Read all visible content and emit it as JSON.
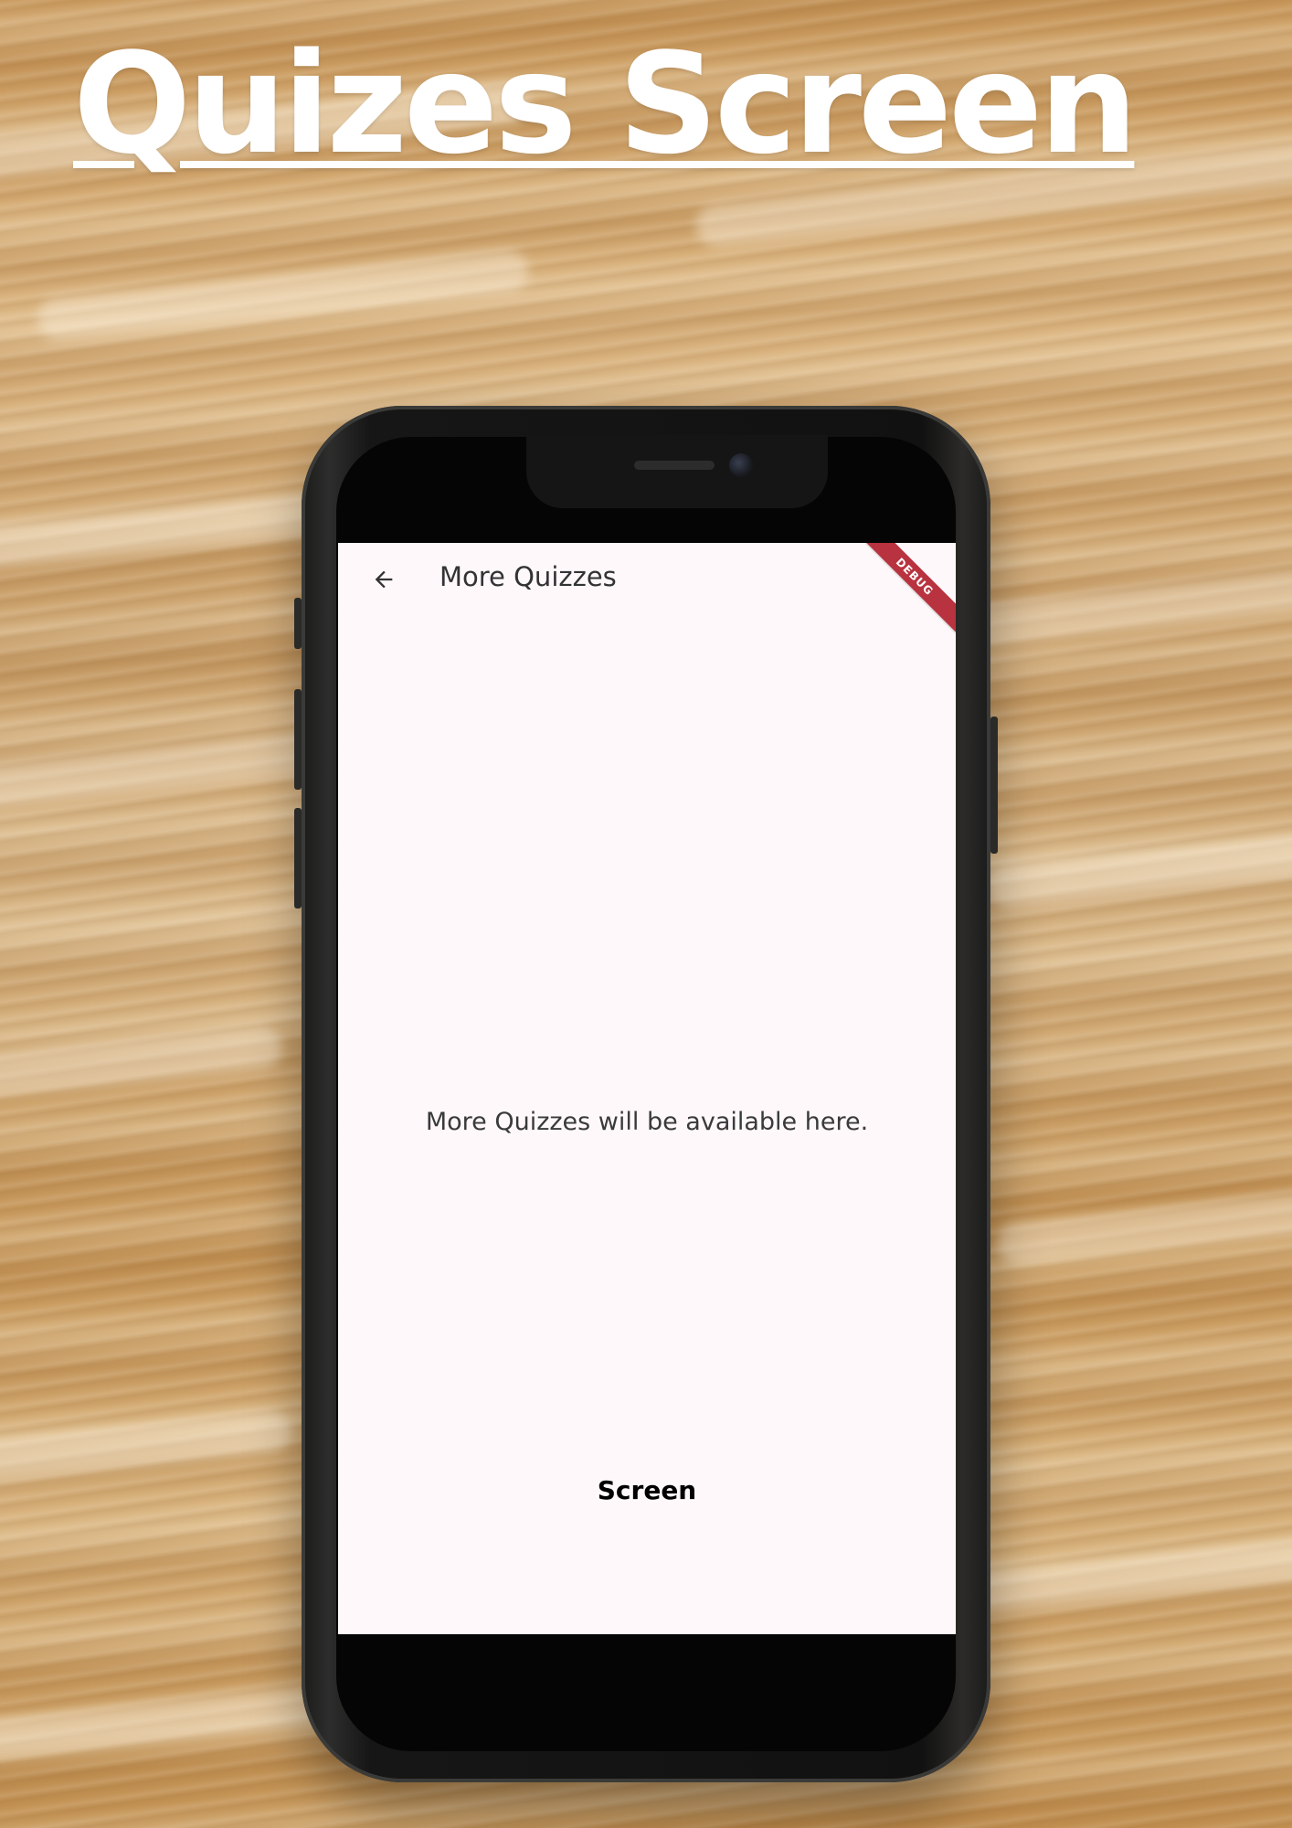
{
  "heading": {
    "title": "Quizes Screen"
  },
  "device": {
    "debug_banner": "DEBUG"
  },
  "app": {
    "appbar": {
      "back_icon": "arrow-left-icon",
      "title": "More Quizzes"
    },
    "body": {
      "message": "More Quizzes will be available here."
    },
    "footer_label": "Screen"
  },
  "colors": {
    "screen_background": "#fef8fb",
    "debug_banner": "#b8333f",
    "heading_text": "#ffffff"
  }
}
